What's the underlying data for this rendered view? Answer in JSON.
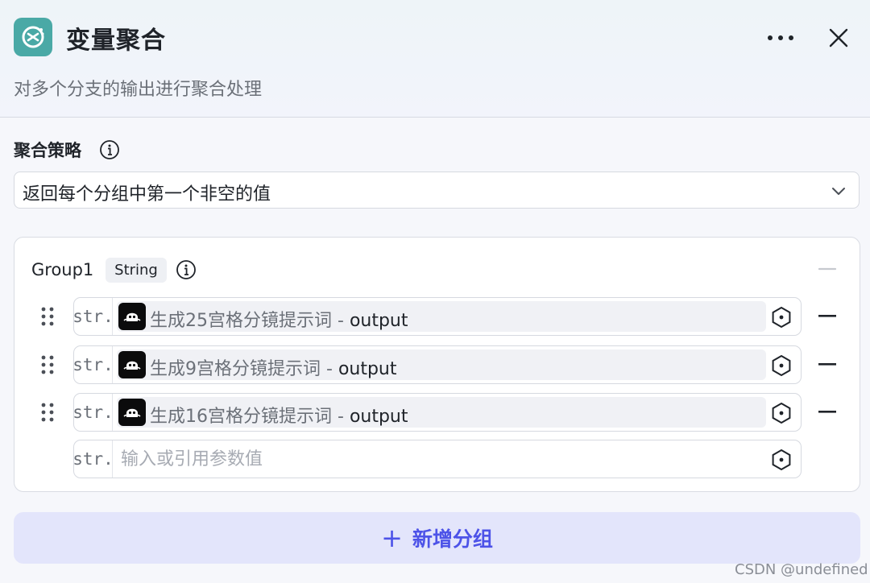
{
  "node": {
    "title": "变量聚合",
    "description": "对多个分支的输出进行聚合处理",
    "icon": "variable-merge-icon",
    "icon_color": "#4aa9a6"
  },
  "header_actions": {
    "more": "more-icon",
    "close": "close-icon"
  },
  "strategy": {
    "label": "聚合策略",
    "selected": "返回每个分组中第一个非空的值"
  },
  "groups": [
    {
      "name": "Group1",
      "type": "String",
      "variables": [
        {
          "type_prefix": "str.",
          "node": "生成25宫格分镜提示词",
          "separator": " - ",
          "field": "output"
        },
        {
          "type_prefix": "str.",
          "node": "生成9宫格分镜提示词",
          "separator": " - ",
          "field": "output"
        },
        {
          "type_prefix": "str.",
          "node": "生成16宫格分镜提示词",
          "separator": " - ",
          "field": "output"
        }
      ],
      "empty_input": {
        "type_prefix": "str.",
        "placeholder": "输入或引用参数值"
      }
    }
  ],
  "add_group_label": "新增分组",
  "add_group_icon": "plus-icon",
  "watermark": "CSDN @undefined",
  "colors": {
    "accent": "#4d53e8",
    "accent_bg": "#e3e5fb"
  }
}
